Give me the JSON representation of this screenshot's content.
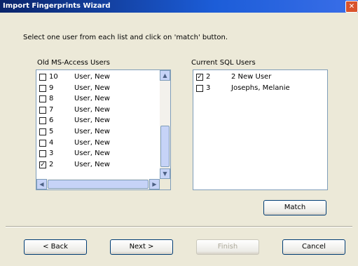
{
  "window": {
    "title": "Import Fingerprints Wizard",
    "close_label": "✕"
  },
  "instruction": "Select one user from each list and click on 'match' button.",
  "old_users": {
    "label": "Old MS-Access Users",
    "items": [
      {
        "id": "10",
        "name": "User, New",
        "checked": false
      },
      {
        "id": "9",
        "name": "User, New",
        "checked": false
      },
      {
        "id": "8",
        "name": "User, New",
        "checked": false
      },
      {
        "id": "7",
        "name": "User, New",
        "checked": false
      },
      {
        "id": "6",
        "name": "User, New",
        "checked": false
      },
      {
        "id": "5",
        "name": "User, New",
        "checked": false
      },
      {
        "id": "4",
        "name": "User, New",
        "checked": false
      },
      {
        "id": "3",
        "name": "User, New",
        "checked": false
      },
      {
        "id": "2",
        "name": "User, New",
        "checked": true
      }
    ]
  },
  "current_users": {
    "label": "Current SQL Users",
    "items": [
      {
        "id": "2",
        "name": "2 New User",
        "checked": true
      },
      {
        "id": "3",
        "name": "Josephs, Melanie",
        "checked": false
      }
    ]
  },
  "buttons": {
    "match": "Match",
    "back": "< Back",
    "next": "Next >",
    "finish": "Finish",
    "cancel": "Cancel"
  }
}
